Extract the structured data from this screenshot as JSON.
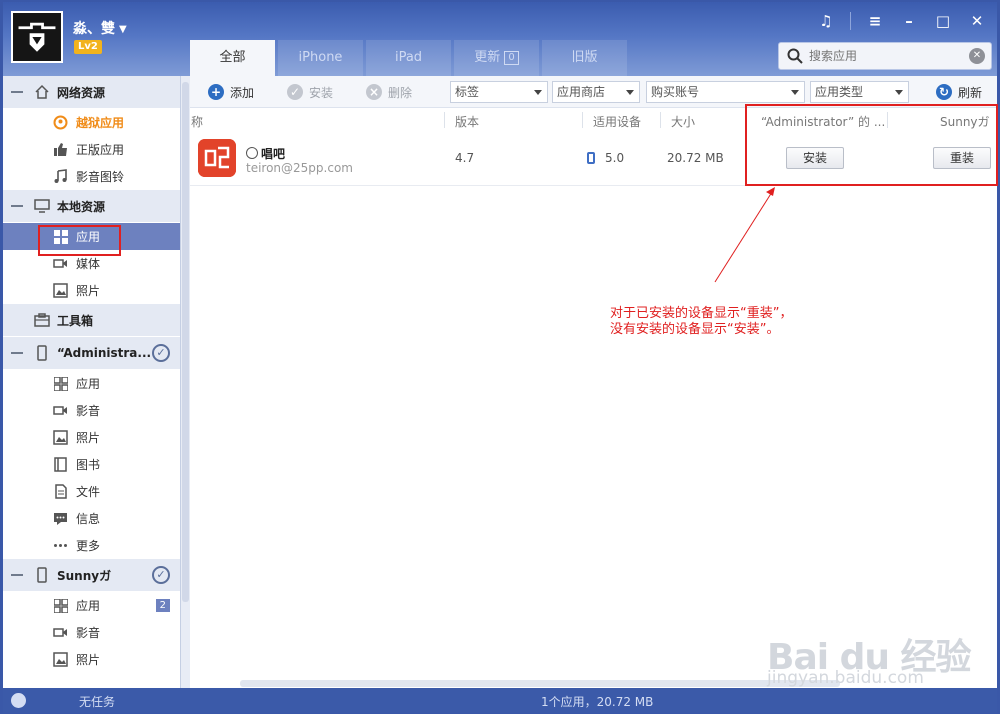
{
  "header": {
    "username": "淼、雙",
    "level": "Lv2",
    "tabs": [
      {
        "label": "全部"
      },
      {
        "label": "iPhone"
      },
      {
        "label": "iPad"
      },
      {
        "label": "更新",
        "count": "0"
      },
      {
        "label": "旧版"
      }
    ],
    "search_placeholder": "搜索应用"
  },
  "sidebar": {
    "online": {
      "label": "网络资源",
      "items": [
        {
          "label": "越狱应用"
        },
        {
          "label": "正版应用"
        },
        {
          "label": "影音图铃"
        }
      ]
    },
    "local": {
      "label": "本地资源",
      "items": [
        {
          "label": "应用"
        },
        {
          "label": "媒体"
        },
        {
          "label": "照片"
        }
      ]
    },
    "toolbox": {
      "label": "工具箱"
    },
    "device1": {
      "label": "“Administra...",
      "items": [
        {
          "label": "应用"
        },
        {
          "label": "影音"
        },
        {
          "label": "照片"
        },
        {
          "label": "图书"
        },
        {
          "label": "文件"
        },
        {
          "label": "信息"
        },
        {
          "label": "更多"
        }
      ]
    },
    "device2": {
      "label": "Sunnyガ",
      "items": [
        {
          "label": "应用",
          "badge": "2"
        },
        {
          "label": "影音"
        },
        {
          "label": "照片"
        }
      ]
    }
  },
  "toolbar": {
    "add": "添加",
    "install": "安装",
    "delete": "删除",
    "filter_tag": "标签",
    "filter_store": "应用商店",
    "filter_account": "购买账号",
    "filter_type": "应用类型",
    "refresh": "刷新"
  },
  "list": {
    "columns": {
      "name": "称",
      "version": "版本",
      "device": "适用设备",
      "size": "大小",
      "device1": "“Administrator” 的 ...",
      "device2": "Sunnyガ"
    },
    "rows": [
      {
        "name": "唱吧",
        "account": "teiron@25pp.com",
        "version": "4.7",
        "device": "5.0",
        "size": "20.72 MB",
        "action1": "安装",
        "action2": "重装"
      }
    ]
  },
  "annotation": {
    "line1": "对于已安装的设备显示“重装”，",
    "line2": "没有安装的设备显示“安装”。"
  },
  "status": {
    "task": "无任务",
    "summary": "1个应用，20.72 MB"
  },
  "watermark": {
    "brand": "Bai du 经验",
    "site": "jingyan.baidu.com"
  },
  "colors": {
    "header": "#3b5caf",
    "accent": "#6d81bf",
    "annotation": "#e02020",
    "jailbreak_label": "#f08c19"
  }
}
